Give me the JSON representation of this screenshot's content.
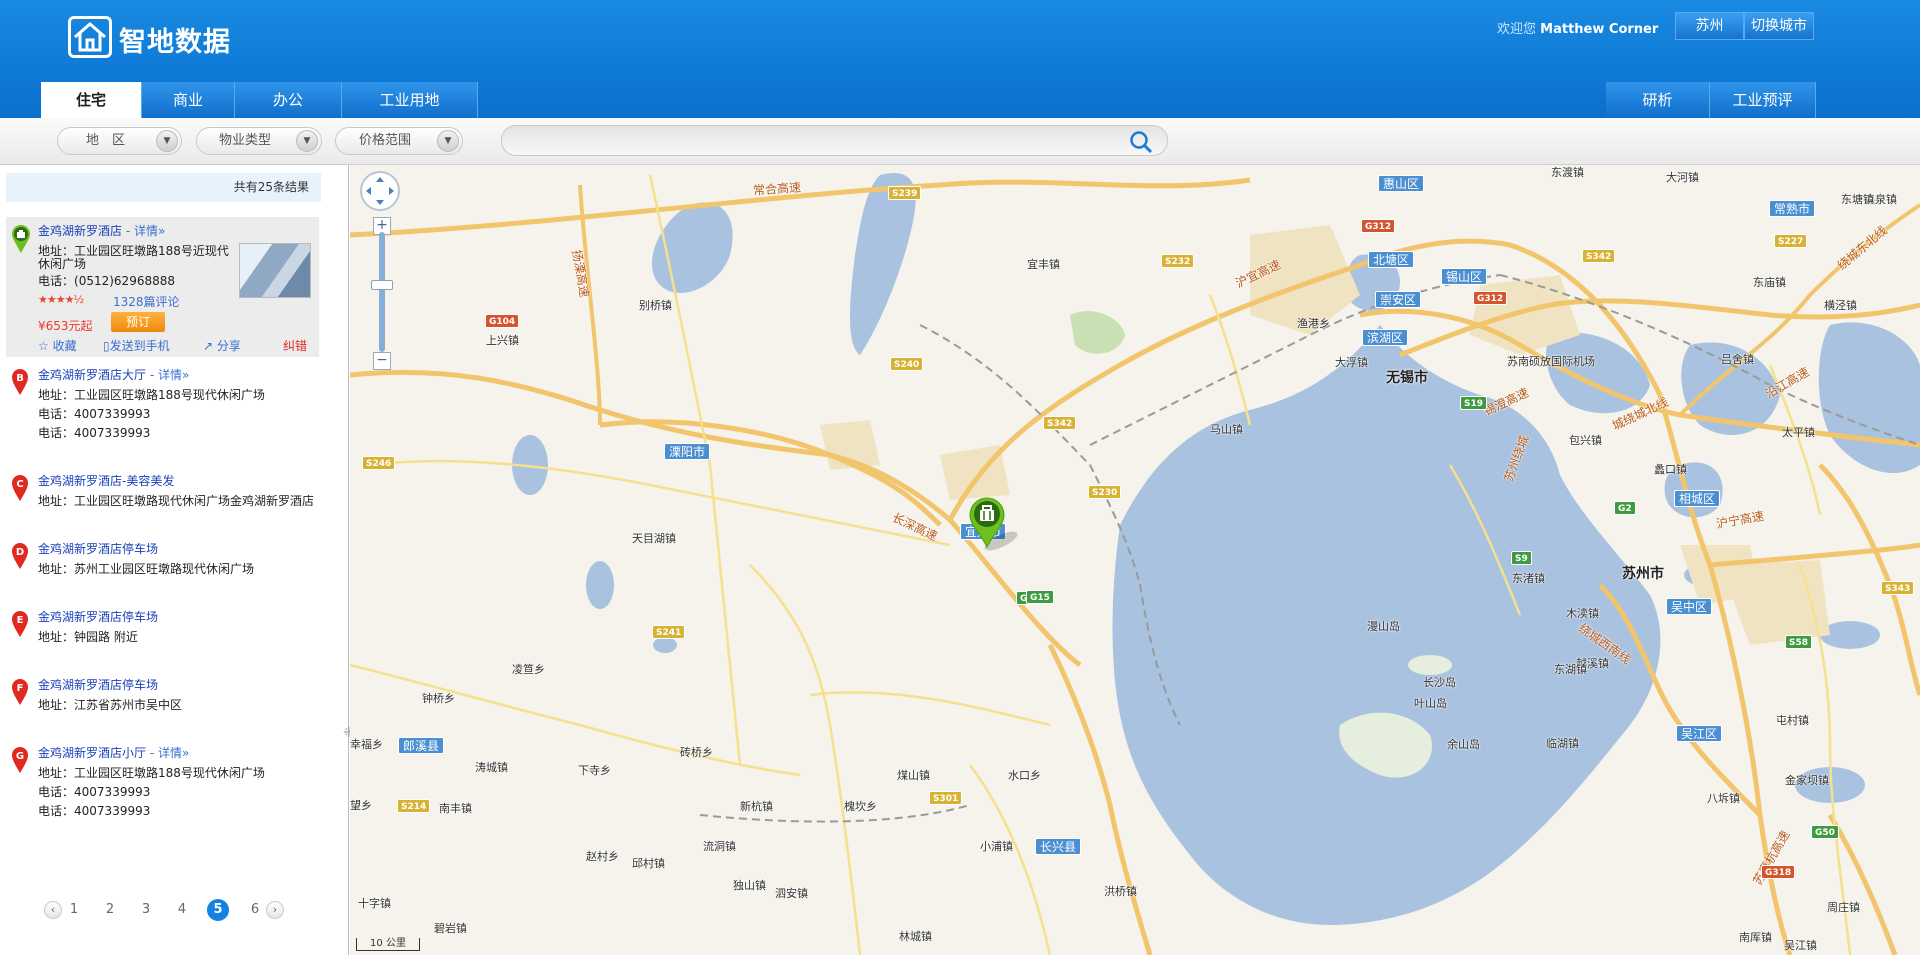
{
  "header": {
    "logo_text": "智地数据",
    "welcome_prefix": "欢迎您",
    "user_name": "Matthew Corner",
    "city": "苏州",
    "switch_city": "切换城市"
  },
  "tabs": [
    {
      "label": "住宅",
      "active": true
    },
    {
      "label": "商业",
      "active": false
    },
    {
      "label": "办公",
      "active": false
    },
    {
      "label": "工业用地",
      "active": false
    }
  ],
  "right_tabs": [
    "研析",
    "工业预评"
  ],
  "filters": {
    "region": "地　区",
    "property_type": "物业类型",
    "price_range": "价格范围",
    "search_value": ""
  },
  "results": {
    "count_text": "共有25条结果",
    "items": [
      {
        "marker": "A",
        "title": "金鸡湖新罗酒店",
        "detail": "- 详情»",
        "address_label": "地址：",
        "address": "工业园区旺墩路188号近现代",
        "address_cont": "休闲广场",
        "phone_label": "电话：",
        "phone": "(0512)62968888",
        "stars": "★★★★½",
        "rating": 4.5,
        "reviews": "1328篇评论",
        "price": "¥653元起",
        "book": "预订",
        "fav": "收藏",
        "send": "发送到手机",
        "share": "分享",
        "report": "纠错"
      },
      {
        "marker": "B",
        "title": "金鸡湖新罗酒店大厅",
        "detail": "- 详情»",
        "address_label": "地址：",
        "address": "工业园区旺墩路188号现代休闲广场",
        "phone_label": "电话：",
        "phone": "4007339993",
        "phone2": "4007339993"
      },
      {
        "marker": "C",
        "title": "金鸡湖新罗酒店-美容美发",
        "address_label": "地址：",
        "address": "工业园区旺墩路现代休闲广场金鸡湖新罗酒店"
      },
      {
        "marker": "D",
        "title": "金鸡湖新罗酒店停车场",
        "address_label": "地址：",
        "address": "苏州工业园区旺墩路现代休闲广场"
      },
      {
        "marker": "E",
        "title": "金鸡湖新罗酒店停车场",
        "address_label": "地址：",
        "address": "钟园路 附近"
      },
      {
        "marker": "F",
        "title": "金鸡湖新罗酒店停车场",
        "address_label": "地址：",
        "address": "江苏省苏州市吴中区"
      },
      {
        "marker": "G",
        "title": "金鸡湖新罗酒店小厅",
        "detail": "- 详情»",
        "address_label": "地址：",
        "address": "工业园区旺墩路188号现代休闲广场",
        "phone_label": "电话：",
        "phone": "4007339993",
        "phone2": "4007339993"
      }
    ]
  },
  "pagination": {
    "prev": "‹",
    "next": "›",
    "pages": [
      "1",
      "2",
      "3",
      "4",
      "5",
      "6"
    ],
    "current": "5"
  },
  "map": {
    "scale": "10 公里",
    "zoom_in": "+",
    "zoom_out": "−",
    "cities": [
      "溧阳市",
      "宜兴市",
      "郎溪县",
      "长兴县",
      "惠山区",
      "北塘区",
      "锡山区",
      "崇安区",
      "滨湖区",
      "常熟市",
      "相城区",
      "吴中区",
      "吴江区"
    ],
    "big_cities": [
      "无锡市",
      "苏州市"
    ],
    "towns": [
      "别桥镇",
      "上兴镇",
      "天目湖镇",
      "凌笪乡",
      "钟桥乡",
      "涛城镇",
      "下寺乡",
      "砖桥乡",
      "南丰镇",
      "新杭镇",
      "槐坎乡",
      "泗安镇",
      "煤山镇",
      "水口乡",
      "小浦镇",
      "洪桥镇",
      "林城镇",
      "流洞镇",
      "独山镇",
      "邱村镇",
      "赵村乡",
      "十字镇",
      "宜丰镇",
      "渔港乡",
      "大浮镇",
      "马山镇",
      "漫山岛",
      "长沙岛",
      "叶山岛",
      "余山岛",
      "东渚镇",
      "临湖镇",
      "越溪镇",
      "木渎镇",
      "包兴镇",
      "蠡口镇",
      "太平镇",
      "吕舍镇",
      "东庙镇",
      "横泾镇",
      "森泉镇",
      "东湖镇",
      "大河镇",
      "东渡镇",
      "苏南硕放国际机场",
      "幸福乡",
      "望乡",
      "屯村镇",
      "八坼镇",
      "金家坝镇",
      "周庄镇",
      "南厍镇",
      "吴江镇",
      "碧岩镇",
      "东塘镇"
    ],
    "roads": [
      "常合高速",
      "沪宜高速",
      "长深高速",
      "扬溧高速",
      "沪蓉高速",
      "沪宁高速",
      "绕城西南线",
      "苏嘉杭高速",
      "沿江高速",
      "锡澄高速",
      "苏州绕城",
      "城绕城北线",
      "绕城东北线"
    ],
    "shields": [
      "S239",
      "G312",
      "S232",
      "S342",
      "G104",
      "S240",
      "S246",
      "S230",
      "G25",
      "S241",
      "S214",
      "S301",
      "G2",
      "S58",
      "S343",
      "G50",
      "G318",
      "S227",
      "G312",
      "S342",
      "G15",
      "S19",
      "S9"
    ]
  }
}
